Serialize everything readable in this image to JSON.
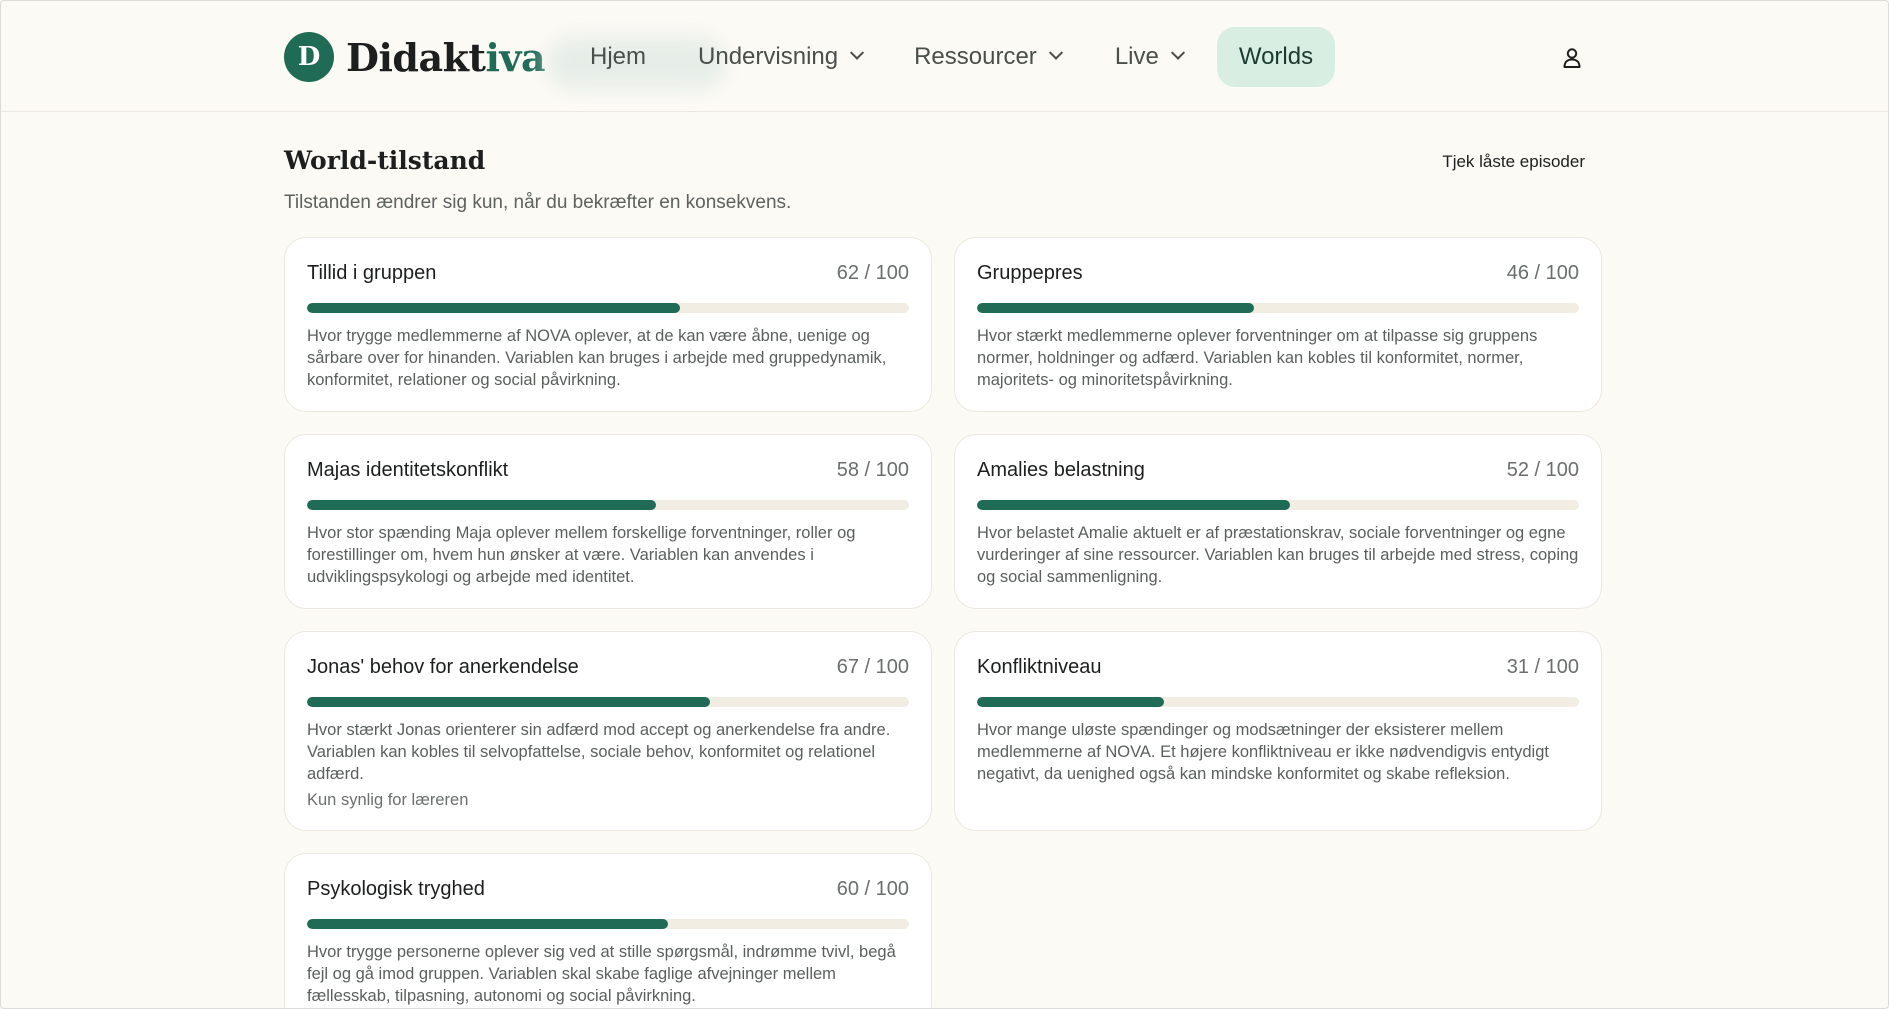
{
  "header": {
    "logo_mark": "D",
    "logo_text_a": "Didakt",
    "logo_text_b": "iva",
    "nav": [
      {
        "label": "Hjem"
      },
      {
        "label": "Undervisning"
      },
      {
        "label": "Ressourcer"
      },
      {
        "label": "Live"
      },
      {
        "label": "Worlds"
      }
    ],
    "active_nav": "Worlds",
    "user_icon": "user-icon"
  },
  "section": {
    "title": "World-tilstand",
    "link": "Tjek låste episoder",
    "subtitle": "Tilstanden ændrer sig kun, når du bekræfter en konsekvens."
  },
  "cards": [
    {
      "title": "Tillid i gruppen",
      "score": "62 / 100",
      "value": 62,
      "description": "Hvor trygge medlemmerne af NOVA oplever, at de kan være åbne, uenige og sårbare over for hinanden. Variablen kan bruges i arbejde med gruppedynamik, konformitet, relationer og social påvirkning.",
      "note": ""
    },
    {
      "title": "Gruppepres",
      "score": "46 / 100",
      "value": 46,
      "description": "Hvor stærkt medlemmerne oplever forventninger om at tilpasse sig gruppens normer, holdninger og adfærd. Variablen kan kobles til konformitet, normer, majoritets- og minoritetspåvirkning.",
      "note": ""
    },
    {
      "title": "Majas identitetskonflikt",
      "score": "58 / 100",
      "value": 58,
      "description": "Hvor stor spænding Maja oplever mellem forskellige forventninger, roller og forestillinger om, hvem hun ønsker at være. Variablen kan anvendes i udviklingspsykologi og arbejde med identitet.",
      "note": ""
    },
    {
      "title": "Amalies belastning",
      "score": "52 / 100",
      "value": 52,
      "description": "Hvor belastet Amalie aktuelt er af præstationskrav, sociale forventninger og egne vurderinger af sine ressourcer. Variablen kan bruges til arbejde med stress, coping og social sammenligning.",
      "note": ""
    },
    {
      "title": "Jonas' behov for anerkendelse",
      "score": "67 / 100",
      "value": 67,
      "description": "Hvor stærkt Jonas orienterer sin adfærd mod accept og anerkendelse fra andre. Variablen kan kobles til selvopfattelse, sociale behov, konformitet og relationel adfærd.",
      "note": "Kun synlig for læreren"
    },
    {
      "title": "Konfliktniveau",
      "score": "31 / 100",
      "value": 31,
      "description": "Hvor mange uløste spændinger og modsætninger der eksisterer mellem medlemmerne af NOVA. Et højere konfliktniveau er ikke nødvendigvis entydigt negativt, da uenighed også kan mindske konformitet og skabe refleksion.",
      "note": ""
    },
    {
      "title": "Psykologisk tryghed",
      "score": "60 / 100",
      "value": 60,
      "description": "Hvor trygge personerne oplever sig ved at stille spørgsmål, indrømme tvivl, begå fejl og gå imod gruppen. Variablen skal skabe faglige afvejninger mellem fællesskab, tilpasning, autonomi og social påvirkning.",
      "note": ""
    }
  ]
}
